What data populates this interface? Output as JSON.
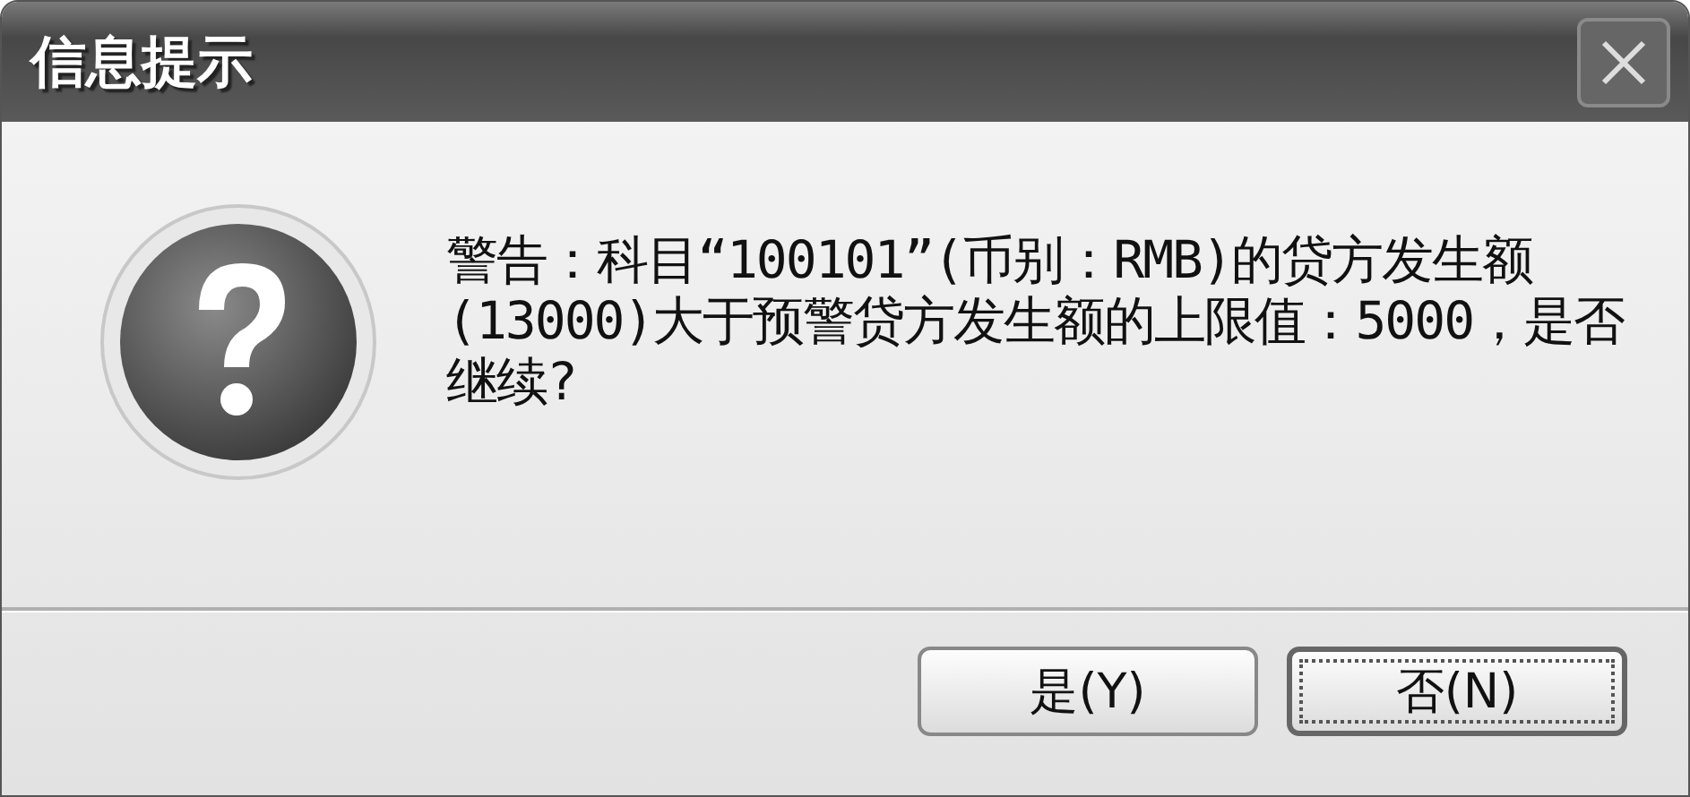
{
  "window": {
    "title": "信息提示"
  },
  "message": {
    "lines": [
      "警告：科目“100101”(币别：RMB)的贷方发生额",
      "(13000)大于预警贷方发生额的上限值：5000，是否",
      "继续?"
    ]
  },
  "buttons": [
    {
      "label": "是(Y)",
      "focused": false
    },
    {
      "label": "否(N)",
      "focused": true
    }
  ]
}
